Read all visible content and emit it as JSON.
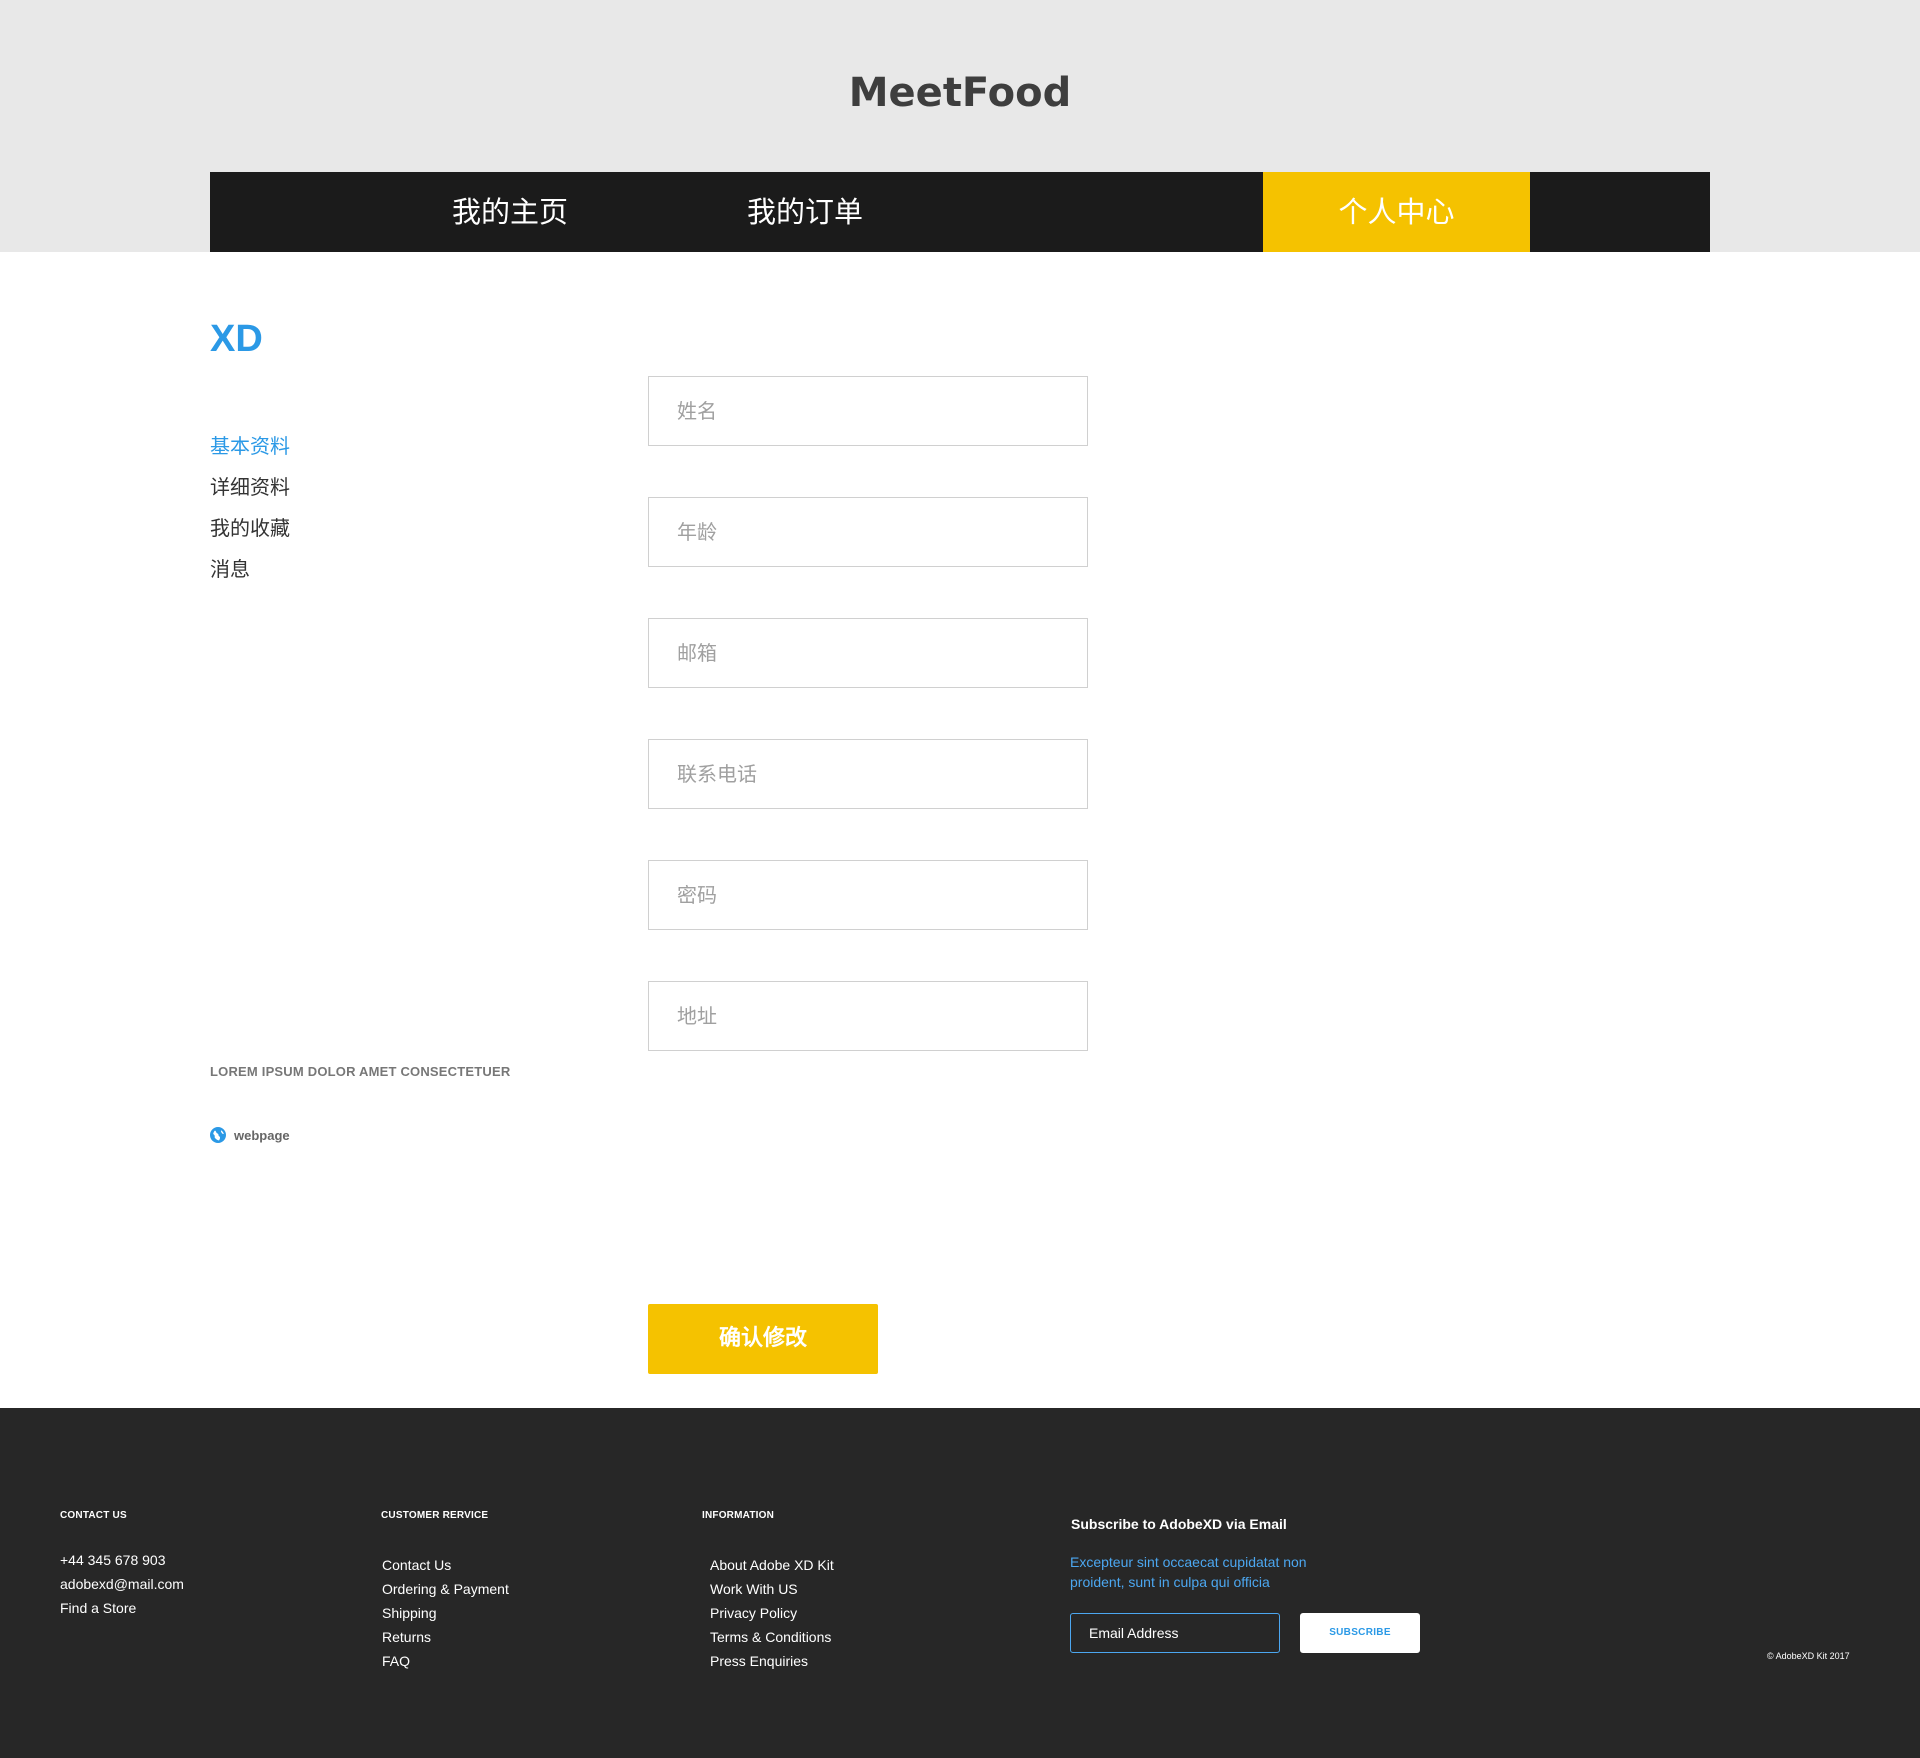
{
  "brand": {
    "logo": "MeetFood"
  },
  "nav": {
    "items": [
      {
        "label": "我的主页"
      },
      {
        "label": "我的订单"
      },
      {
        "label": "个人中心"
      }
    ]
  },
  "colors": {
    "accent": "#f5c200",
    "link": "#2b99e6",
    "nav_bg": "#1b1b1b",
    "header_bg": "#e8e8e8",
    "footer_bg": "#272727"
  },
  "profile": {
    "name": "XD",
    "menu": [
      {
        "label": "基本资料"
      },
      {
        "label": "详细资料"
      },
      {
        "label": "我的收藏"
      },
      {
        "label": "消息"
      }
    ],
    "tagline": "LOREM IPSUM DOLOR AMET CONSECTETUER",
    "webpage_label": "webpage",
    "webpage_icon": "globe-icon"
  },
  "form": {
    "fields": [
      {
        "placeholder": "姓名",
        "value": ""
      },
      {
        "placeholder": "年龄",
        "value": ""
      },
      {
        "placeholder": "邮箱",
        "value": ""
      },
      {
        "placeholder": "联系电话",
        "value": ""
      },
      {
        "placeholder": "密码",
        "value": ""
      },
      {
        "placeholder": "地址",
        "value": ""
      }
    ],
    "submit_label": "确认修改"
  },
  "footer": {
    "contact": {
      "heading": "CONTACT US",
      "items": [
        "+44 345 678 903",
        "adobexd@mail.com",
        "Find a Store"
      ]
    },
    "service": {
      "heading": "CUSTOMER RERVICE",
      "items": [
        "Contact Us",
        "Ordering & Payment",
        "Shipping",
        "Returns",
        "FAQ"
      ]
    },
    "info": {
      "heading": "INFORMATION",
      "items": [
        "About Adobe XD Kit",
        "Work With US",
        "Privacy Policy",
        "Terms & Conditions",
        "Press Enquiries"
      ]
    },
    "subscribe": {
      "title": "Subscribe to AdobeXD via Email",
      "description": "Excepteur sint occaecat cupidatat non proident, sunt in culpa qui officia",
      "email_placeholder": "Email Address",
      "button_label": "SUBSCRIBE"
    },
    "copyright": "© AdobeXD Kit 2017"
  }
}
